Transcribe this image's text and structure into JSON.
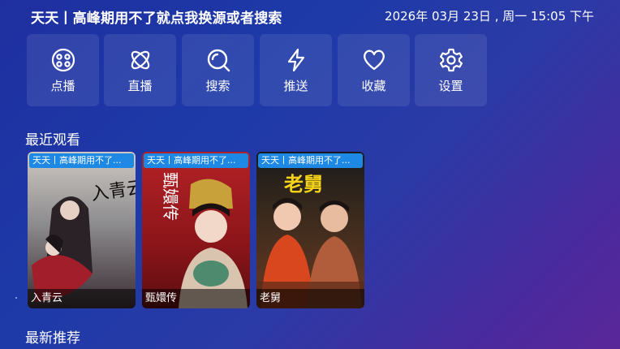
{
  "header": {
    "title": "天天丨高峰期用不了就点我换源或者搜索",
    "datetime": "2026年 03月 23日 , 周一 15:05 下午"
  },
  "menu": {
    "items": [
      {
        "label": "点播",
        "icon": "film-reel-icon"
      },
      {
        "label": "直播",
        "icon": "atom-icon"
      },
      {
        "label": "搜索",
        "icon": "search-icon"
      },
      {
        "label": "推送",
        "icon": "lightning-icon"
      },
      {
        "label": "收藏",
        "icon": "heart-icon"
      },
      {
        "label": "设置",
        "icon": "gear-icon"
      }
    ]
  },
  "recent": {
    "title": "最近观看",
    "items": [
      {
        "badge": "天天丨高峰期用不了...",
        "name": "入青云",
        "poster_text": "入青云"
      },
      {
        "badge": "天天丨高峰期用不了...",
        "name": "甄嬛传",
        "poster_text": "甄嬛传"
      },
      {
        "badge": "天天丨高峰期用不了...",
        "name": "老舅",
        "poster_text": "老舅"
      }
    ]
  },
  "recommend": {
    "title": "最新推荐"
  },
  "colors": {
    "accent_badge": "#1e88e5",
    "tile_bg": "rgba(255,255,255,0.09)"
  }
}
